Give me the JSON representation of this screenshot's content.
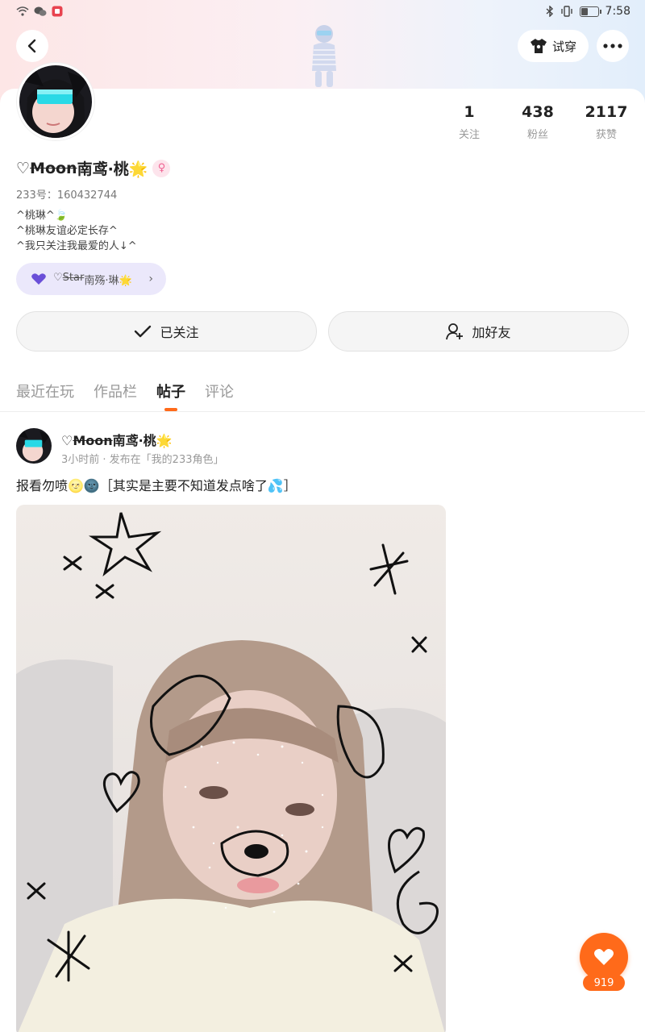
{
  "status_bar": {
    "time": "7:58"
  },
  "header": {
    "tryon_label": "试穿"
  },
  "profile": {
    "stats": [
      {
        "value": "1",
        "label": "关注"
      },
      {
        "value": "438",
        "label": "粉丝"
      },
      {
        "value": "2117",
        "label": "获赞"
      }
    ],
    "name_prefix": "♡",
    "name_struck": "Moon",
    "name_main": "南鸢·桃🌟",
    "gender_symbol": "♀",
    "uid": "233号：160432744",
    "bio_lines": [
      "^桃琳^🍃",
      "^桃琳友谊必定长存^",
      "^我只关注我最爱的人↓^"
    ],
    "cp": {
      "prefix": "♡",
      "struck": "Star",
      "name": "南殇·琳🌟"
    },
    "follow_label": "已关注",
    "add_friend_label": "加好友"
  },
  "tabs": [
    "最近在玩",
    "作品栏",
    "帖子",
    "评论"
  ],
  "post": {
    "author_prefix": "♡",
    "author_struck": "Moon",
    "author_main": "南鸢·桃🌟",
    "meta": "3小时前 · 发布在「我的233角色」",
    "text": "报看勿喷🌝🌚［其实是主要不知道发点啥了💦］",
    "like_count": "919"
  },
  "colors": {
    "accent": "#ff6a1a",
    "cp_pill": "#ebe8fb"
  }
}
